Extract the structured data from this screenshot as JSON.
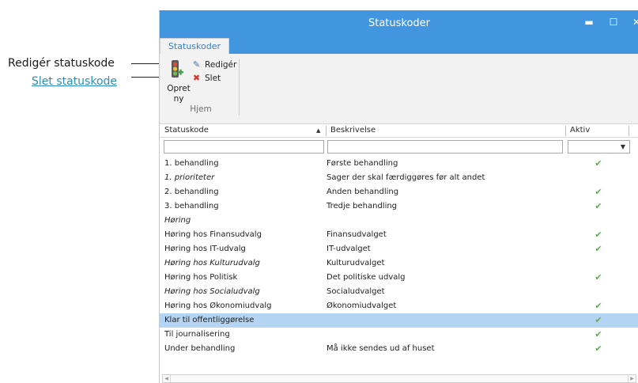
{
  "callouts": {
    "edit": "Redigér statuskode",
    "delete": "Slet statuskode"
  },
  "window": {
    "title": "Statuskoder",
    "minimize_glyph": "▬",
    "maximize_glyph": "☐",
    "close_glyph": "✕"
  },
  "tab": {
    "label": "Statuskoder"
  },
  "ribbon": {
    "create_label": "Opret\nny",
    "edit_label": "Redigér",
    "delete_label": "Slet",
    "group_label": "Hjem"
  },
  "grid": {
    "columns": {
      "code": "Statuskode",
      "description": "Beskrivelse",
      "active": "Aktiv"
    },
    "sort_glyph": "▲",
    "filter_dropdown_glyph": "▼",
    "check_glyph": "✔",
    "rows": [
      {
        "code": "1. behandling",
        "description": "Første behandling",
        "active": true,
        "italic": false,
        "selected": false
      },
      {
        "code": "1. prioriteter",
        "description": "Sager der skal færdiggøres før alt andet",
        "active": false,
        "italic": true,
        "selected": false
      },
      {
        "code": "2. behandling",
        "description": "Anden behandling",
        "active": true,
        "italic": false,
        "selected": false
      },
      {
        "code": "3. behandling",
        "description": "Tredje behandling",
        "active": true,
        "italic": false,
        "selected": false
      },
      {
        "code": "Høring",
        "description": "",
        "active": false,
        "italic": true,
        "selected": false
      },
      {
        "code": "Høring hos Finansudvalg",
        "description": "Finansudvalget",
        "active": true,
        "italic": false,
        "selected": false
      },
      {
        "code": "Høring hos IT-udvalg",
        "description": "IT-udvalget",
        "active": true,
        "italic": false,
        "selected": false
      },
      {
        "code": "Høring hos Kulturudvalg",
        "description": "Kulturudvalget",
        "active": false,
        "italic": true,
        "selected": false
      },
      {
        "code": "Høring hos Politisk",
        "description": "Det politiske udvalg",
        "active": true,
        "italic": false,
        "selected": false
      },
      {
        "code": "Høring hos Socialudvalg",
        "description": "Socialudvalget",
        "active": false,
        "italic": true,
        "selected": false
      },
      {
        "code": "Høring hos Økonomiudvalg",
        "description": "Økonomiudvalget",
        "active": true,
        "italic": false,
        "selected": false
      },
      {
        "code": "Klar til offentliggørelse",
        "description": "",
        "active": true,
        "italic": false,
        "selected": true
      },
      {
        "code": "Til journalisering",
        "description": "",
        "active": true,
        "italic": false,
        "selected": false
      },
      {
        "code": "Under behandling",
        "description": "Må ikke sendes ud af huset",
        "active": true,
        "italic": false,
        "selected": false
      }
    ]
  },
  "scrollbar": {
    "left_glyph": "◀",
    "right_glyph": "▶"
  },
  "colors": {
    "titlebar": "#4296e0",
    "selected_row": "#b3d4f2",
    "check": "#6aa55e",
    "delete_icon": "#d8322e",
    "callout_link": "#2a8fb5"
  },
  "icons": {
    "create": "traffic-light-plus-icon",
    "edit": "edit-note-icon",
    "delete": "red-x-icon",
    "active": "checkmark-icon"
  }
}
